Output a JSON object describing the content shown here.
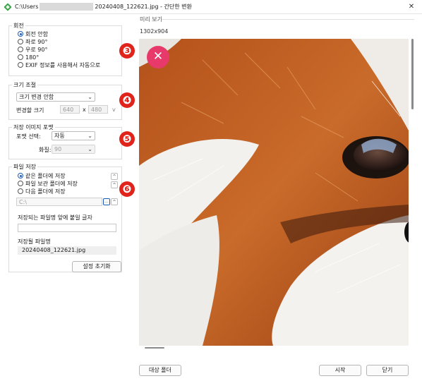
{
  "window": {
    "title_path": "C:\\Users",
    "title_file": "20240408_122621.jpg - 간단한 변환",
    "close_glyph": "✕"
  },
  "rotation": {
    "legend": "회전",
    "options": [
      "회전 안함",
      "좌로 90°",
      "우로 90°",
      "180°",
      "EXIF 정보를 사용해서 자동으로"
    ],
    "selected_index": 0
  },
  "resize": {
    "legend": "크기 조절",
    "mode": "크기 변경 안함",
    "size_label": "변경할 크기",
    "width": "640",
    "separator": "x",
    "height": "480",
    "dropdown_glyph": "v"
  },
  "format": {
    "legend": "저장 이미지 포맷",
    "format_label": "포맷 선택:",
    "format_value": "자동",
    "quality_label": "화질:",
    "quality_value": "90"
  },
  "save": {
    "legend": "파일 저장",
    "options": [
      "같은 폴더에 저장",
      "파일 보관 폴더에 저장",
      "다음 폴더에 저장"
    ],
    "selected_index": 0,
    "folder_path": "C:\\",
    "browse_label": "...",
    "arrow_up": "^",
    "prefix_label": "저장되는 파일명 앞에 붙일 글자",
    "prefix_value": "",
    "filename_label": "저장될 파일명",
    "filename_value": "20240408_122621.jpg"
  },
  "reset_label": "설정 초기화",
  "preview": {
    "label": "미리 보기",
    "dimensions": "1302x904",
    "close_glyph": "✕"
  },
  "buttons": {
    "target_folder": "대상 폴더",
    "start": "시작",
    "close": "닫기"
  },
  "annotations": [
    "❸",
    "❹",
    "❺",
    "❻"
  ],
  "colors": {
    "badge": "#e0231b",
    "overlay_close": "#e8396b",
    "accent": "#1d5bb8"
  }
}
